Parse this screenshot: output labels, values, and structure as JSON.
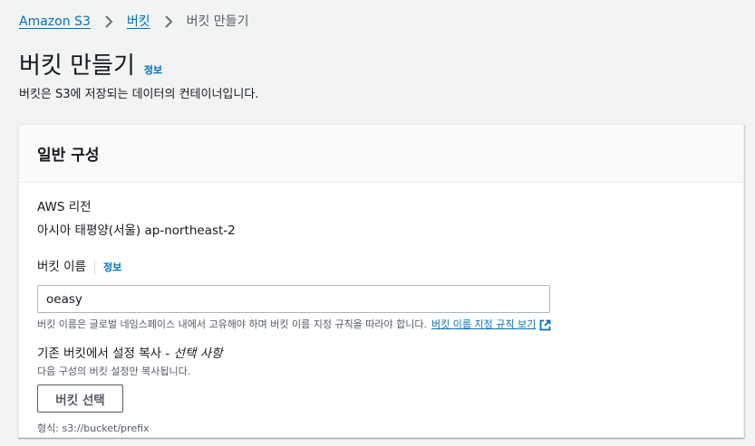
{
  "breadcrumb": {
    "items": [
      {
        "label": "Amazon S3"
      },
      {
        "label": "버킷"
      },
      {
        "label": "버킷 만들기"
      }
    ]
  },
  "header": {
    "title": "버킷 만들기",
    "info_label": "정보",
    "description": "버킷은 S3에 저장되는 데이터의 컨테이너입니다."
  },
  "general": {
    "title": "일반 구성",
    "region_label": "AWS 리전",
    "region_value": "아시아 태평양(서울) ap-northeast-2",
    "bucket_name_label": "버킷 이름",
    "bucket_name_info": "정보",
    "bucket_name_value": "oeasy",
    "bucket_name_hint": "버킷 이름은 글로벌 네임스페이스 내에서 고유해야 하며 버킷 이름 지정 규칙을 따라야 합니다.",
    "naming_rules_link": "버킷 이름 지정 규칙 보기",
    "copy_settings_label": "기존 버킷에서 설정 복사 -",
    "copy_settings_optional": "선택 사항",
    "copy_settings_desc": "다음 구성의 버킷 설정만 복사됩니다.",
    "choose_bucket_button": "버킷 선택",
    "format_hint": "형식: s3://bucket/prefix"
  },
  "colors": {
    "link": "#0073bb",
    "text": "#16191f",
    "secondary_text": "#545b64",
    "page_bg": "#f2f3f3"
  }
}
